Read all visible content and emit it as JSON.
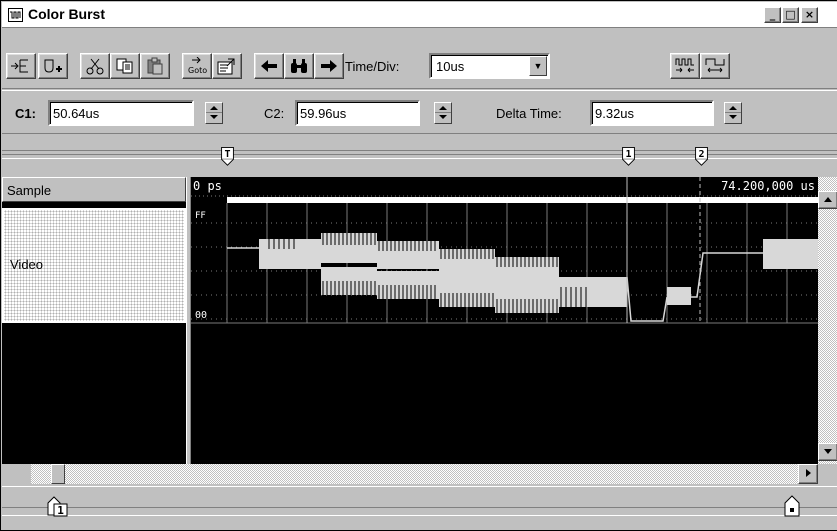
{
  "window": {
    "title": "Color Burst"
  },
  "toolbar": {
    "timediv_label": "Time/Div:",
    "timediv_value": "10us",
    "goto_label": "Goto"
  },
  "cursors": {
    "c1_label": "C1:",
    "c1_value": "50.64us",
    "c2_label": "C2:",
    "c2_value": "59.96us",
    "delta_label": "Delta Time:",
    "delta_value": "9.32us"
  },
  "markers": {
    "trigger": "T",
    "m1": "1",
    "m2": "2",
    "bottom_marker": "1"
  },
  "channels": {
    "header": "Sample",
    "video_label": "Video"
  },
  "waveform": {
    "start_time": "0 ps",
    "end_time": "74.200,000 us",
    "y_top_label": "FF",
    "y_bottom_label": "00"
  },
  "colors": {
    "background": "#c0c0c0",
    "trace": "#d8d8d8",
    "grid": "#7a7a7a",
    "cursor": "#c0c0c0"
  }
}
